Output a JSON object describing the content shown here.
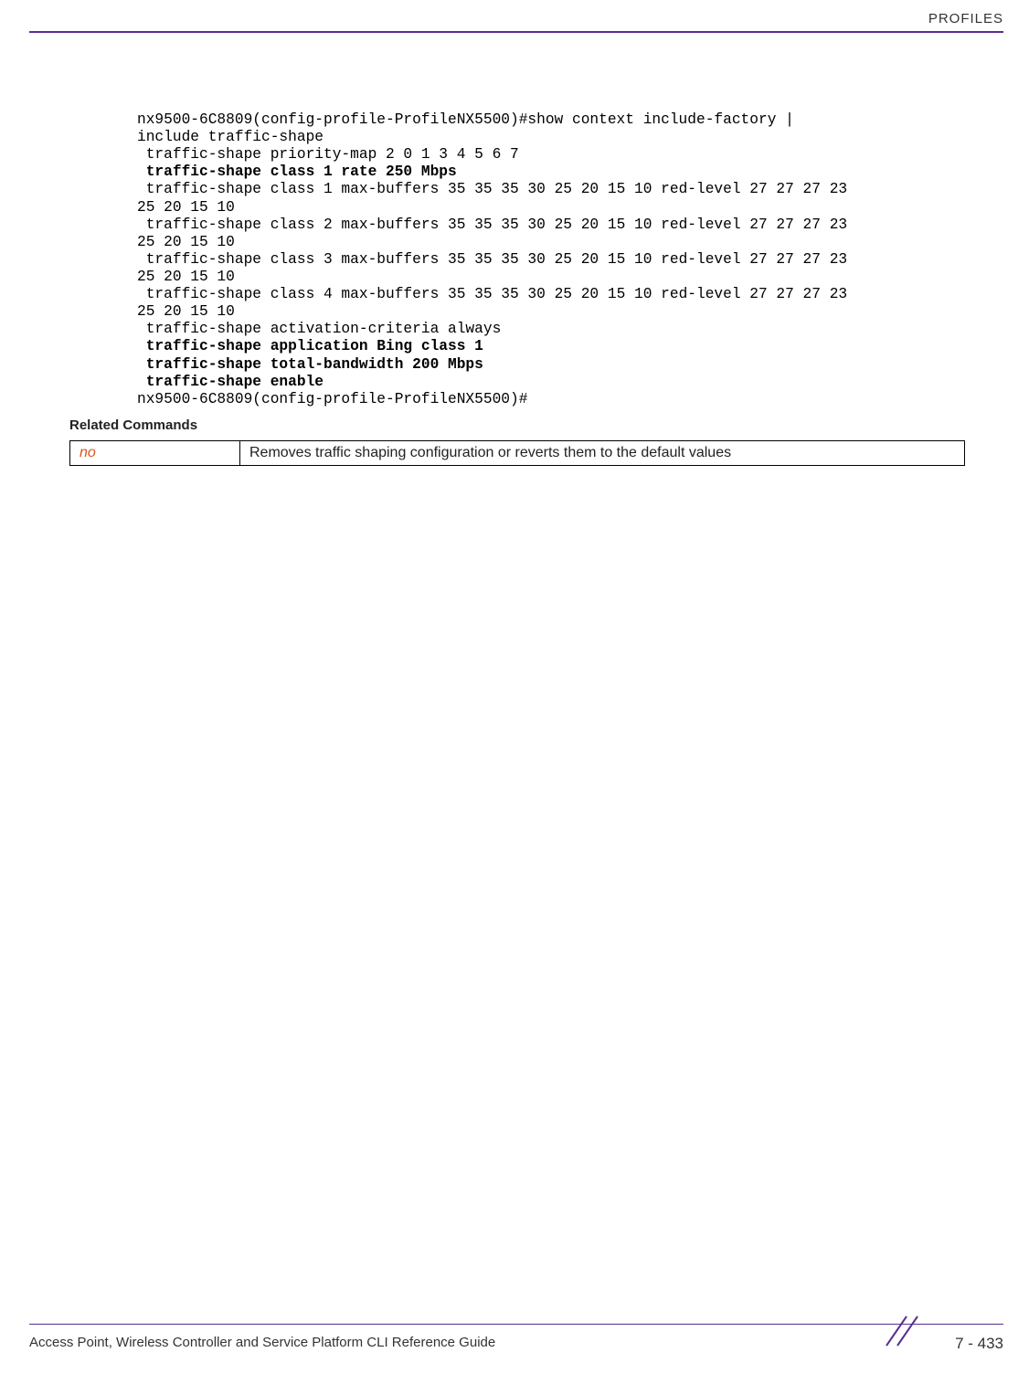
{
  "header": {
    "section_title": "PROFILES"
  },
  "code": {
    "l1": "nx9500-6C8809(config-profile-ProfileNX5500)#show context include-factory | ",
    "l2": "include traffic-shape",
    "l3": " traffic-shape priority-map 2 0 1 3 4 5 6 7",
    "l4": " traffic-shape class 1 rate 250 Mbps",
    "l5": " traffic-shape class 1 max-buffers 35 35 35 30 25 20 15 10 red-level 27 27 27 23 ",
    "l6": "25 20 15 10",
    "l7": " traffic-shape class 2 max-buffers 35 35 35 30 25 20 15 10 red-level 27 27 27 23 ",
    "l8": "25 20 15 10",
    "l9": " traffic-shape class 3 max-buffers 35 35 35 30 25 20 15 10 red-level 27 27 27 23 ",
    "l10": "25 20 15 10",
    "l11": " traffic-shape class 4 max-buffers 35 35 35 30 25 20 15 10 red-level 27 27 27 23 ",
    "l12": "25 20 15 10",
    "l13": " traffic-shape activation-criteria always",
    "l14": " traffic-shape application Bing class 1",
    "l15": " traffic-shape total-bandwidth 200 Mbps",
    "l16": " traffic-shape enable",
    "l17": "nx9500-6C8809(config-profile-ProfileNX5500)#"
  },
  "related_commands": {
    "heading": "Related Commands",
    "rows": [
      {
        "name": "no",
        "desc": "Removes traffic shaping configuration or reverts them to the default values"
      }
    ]
  },
  "footer": {
    "guide_title": "Access Point, Wireless Controller and Service Platform CLI Reference Guide",
    "page_number": "7 - 433"
  }
}
